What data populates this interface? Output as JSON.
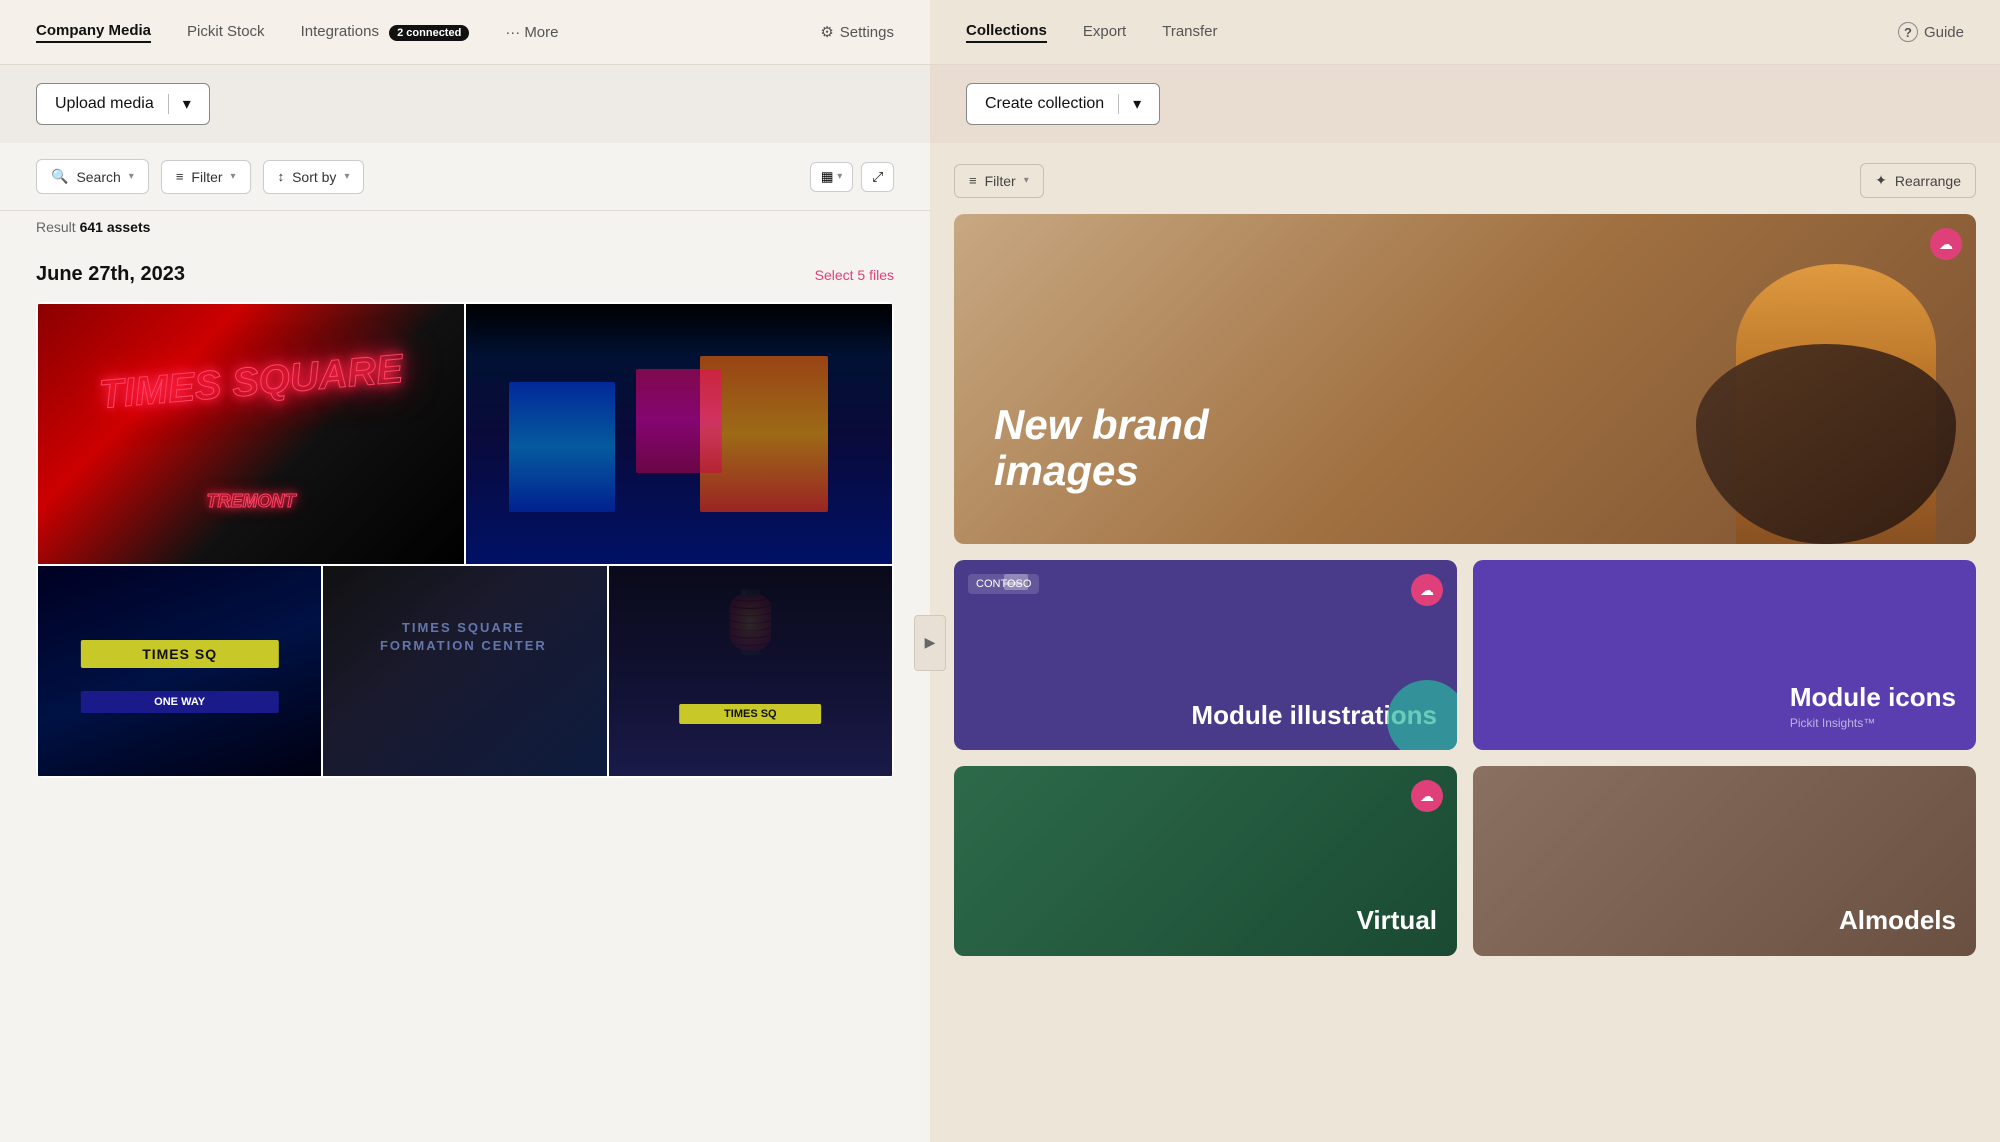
{
  "nav": {
    "left_tabs": [
      {
        "id": "company-media",
        "label": "Company Media",
        "active": true
      },
      {
        "id": "pickit-stock",
        "label": "Pickit Stock",
        "active": false
      },
      {
        "id": "integrations",
        "label": "Integrations",
        "active": false
      },
      {
        "id": "more",
        "label": "··· More",
        "active": false
      }
    ],
    "integrations_badge": "2 connected",
    "settings_label": "Settings",
    "right_tabs": [
      {
        "id": "collections",
        "label": "Collections",
        "active": true
      },
      {
        "id": "export",
        "label": "Export",
        "active": false
      },
      {
        "id": "transfer",
        "label": "Transfer",
        "active": false
      }
    ],
    "guide_label": "Guide"
  },
  "toolbar": {
    "upload_label": "Upload media",
    "create_collection_label": "Create collection"
  },
  "filter_bar": {
    "search_placeholder": "Search",
    "filter_label": "Filter",
    "sort_by_label": "Sort by",
    "rearrange_label": "Rearrange",
    "filter_right_label": "Filter"
  },
  "results": {
    "text": "Result",
    "count": "641 assets"
  },
  "media_section": {
    "date": "June 27th, 2023",
    "select_files_label": "Select 5 files",
    "images": [
      {
        "id": "ts1",
        "alt": "Times Square neon sign",
        "class": "times-sq-1"
      },
      {
        "id": "ts2",
        "alt": "Times Square aerial night",
        "class": "times-sq-2"
      },
      {
        "id": "ts3",
        "alt": "Times Square street sign",
        "class": "times-sq-3"
      },
      {
        "id": "ts4",
        "alt": "Times Square information center",
        "class": "times-sq-4"
      },
      {
        "id": "ts5",
        "alt": "Times Square night lights",
        "class": "times-sq-5"
      }
    ]
  },
  "collections": {
    "items": [
      {
        "id": "new-brand",
        "title": "New brand\nimages",
        "size": "large",
        "has_badge": true,
        "badge_icon": "☁"
      },
      {
        "id": "module-illustrations",
        "title": "Module\nillustrations",
        "size": "small",
        "has_badge": true,
        "badge_icon": "☁",
        "contoso": "CONTOSO"
      },
      {
        "id": "module-icons",
        "title": "Module\nicons",
        "size": "small",
        "has_badge": false,
        "subtitle": "Pickit Insights™"
      },
      {
        "id": "virtual",
        "title": "Virtual",
        "size": "small",
        "has_badge": true,
        "badge_icon": "☁"
      },
      {
        "id": "almodels",
        "title": "Almodels",
        "size": "small",
        "has_badge": false
      }
    ]
  },
  "icons": {
    "search": "🔍",
    "filter": "⚙",
    "sort": "↕",
    "grid": "▦",
    "expand": "⤢",
    "settings": "⚙",
    "guide": "?",
    "chevron_down": "▾",
    "cloud": "☁",
    "rearrange": "✦",
    "arrow_right": "▶",
    "dots": "···"
  },
  "colors": {
    "accent_pink": "#e0407a",
    "nav_bg_left": "#f5f0ea",
    "nav_bg_right": "#ede5d8",
    "panel_left": "#f5f3f0",
    "panel_right": "#ede5d8",
    "toolbar_left": "#eeebe6",
    "toolbar_right": "#e8ddd0"
  }
}
